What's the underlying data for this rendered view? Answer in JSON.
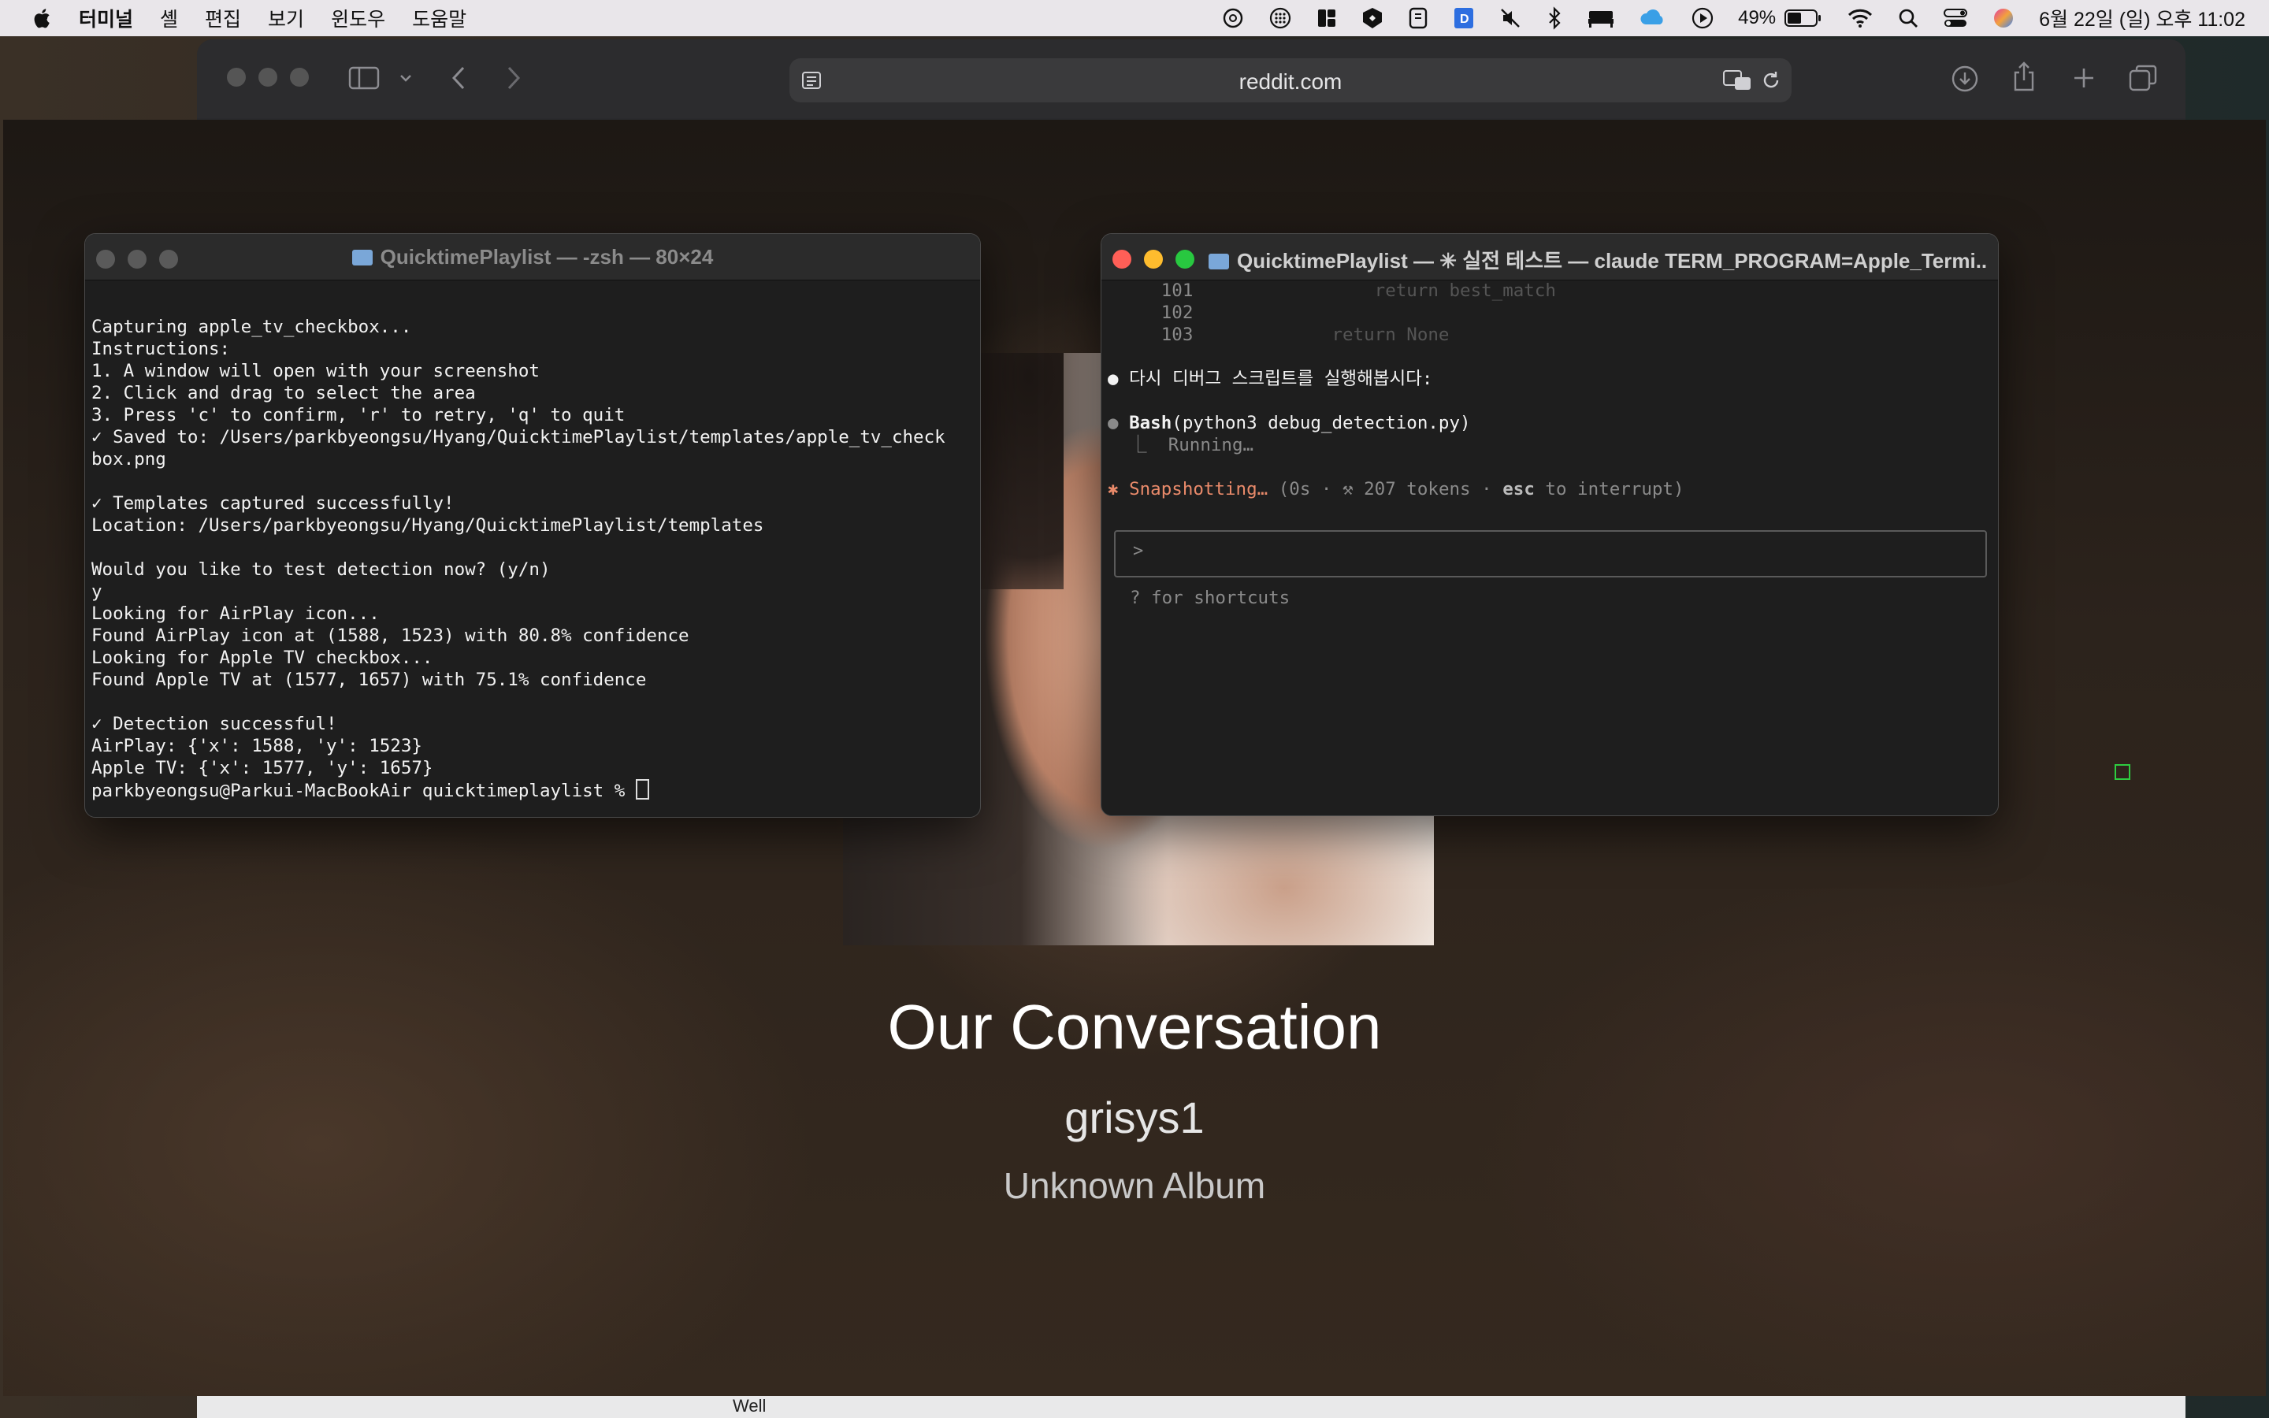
{
  "menubar": {
    "app_name": "터미널",
    "items": [
      "셸",
      "편집",
      "보기",
      "윈도우",
      "도움말"
    ],
    "battery_percent": "49%",
    "datetime": "6월 22일 (일) 오후 11:02",
    "status_icons": [
      "chatgpt-icon",
      "grid-icon",
      "layout-icon",
      "shield-icon",
      "app-icon",
      "doc-icon",
      "mute-icon",
      "bluetooth-icon",
      "bed-icon",
      "cloud-icon",
      "play-icon",
      "battery-icon",
      "wifi-icon",
      "search-icon",
      "control-center-icon",
      "siri-icon"
    ]
  },
  "safari": {
    "url": "reddit.com",
    "bottom_text": "Well"
  },
  "now_playing": {
    "title": "Our Conversation",
    "artist": "grisys1",
    "album": "Unknown Album"
  },
  "terminal_left": {
    "title": "QuicktimePlaylist — -zsh — 80×24",
    "lines": [
      "",
      "Capturing apple_tv_checkbox...",
      "Instructions:",
      "1. A window will open with your screenshot",
      "2. Click and drag to select the area",
      "3. Press 'c' to confirm, 'r' to retry, 'q' to quit",
      "✓ Saved to: /Users/parkbyeongsu/Hyang/QuicktimePlaylist/templates/apple_tv_check",
      "box.png",
      "",
      "✓ Templates captured successfully!",
      "Location: /Users/parkbyeongsu/Hyang/QuicktimePlaylist/templates",
      "",
      "Would you like to test detection now? (y/n)",
      "y",
      "Looking for AirPlay icon...",
      "Found AirPlay icon at (1588, 1523) with 80.8% confidence",
      "Looking for Apple TV checkbox...",
      "Found Apple TV at (1577, 1657) with 75.1% confidence",
      "",
      "✓ Detection successful!",
      "AirPlay: {'x': 1588, 'y': 1523}",
      "Apple TV: {'x': 1577, 'y': 1657}"
    ],
    "prompt": "parkbyeongsu@Parkui-MacBookAir quicktimeplaylist % "
  },
  "terminal_right": {
    "title": "QuicktimePlaylist — ✳ 실전 테스트 — claude TERM_PROGRAM=Apple_Termi...",
    "code_lines": [
      {
        "num": "101",
        "code": "                return best_match"
      },
      {
        "num": "102",
        "code": ""
      },
      {
        "num": "103",
        "code": "            return None"
      }
    ],
    "message": "다시 디버그 스크립트를 실행해봅시다:",
    "tool_name": "Bash",
    "tool_args": "(python3 debug_detection.py)",
    "tool_status": "Running…",
    "spinner_label": "Snapshotting…",
    "spinner_info": "(0s · ⚒ 207 tokens · ",
    "spinner_key": "esc",
    "spinner_tail": " to interrupt)",
    "input_prompt": ">",
    "shortcuts_hint": "? for shortcuts"
  }
}
